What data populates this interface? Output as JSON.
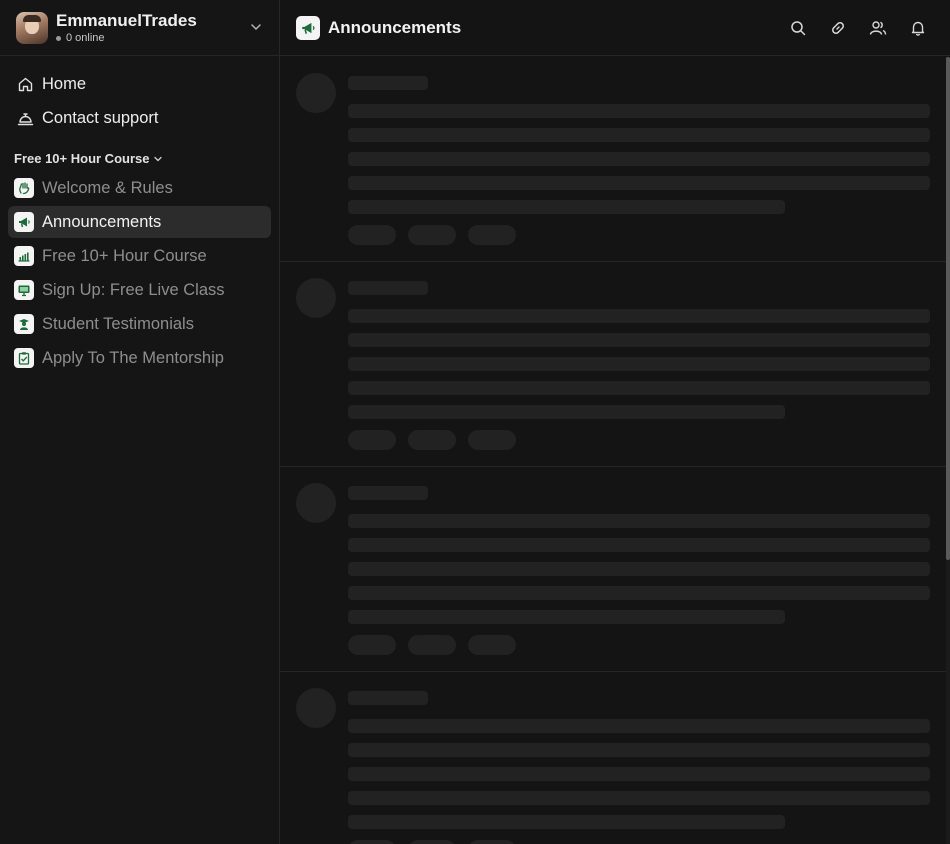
{
  "server": {
    "name": "EmmanuelTrades",
    "online": "0 online"
  },
  "nav": [
    {
      "label": "Home",
      "icon": "home-icon"
    },
    {
      "label": "Contact support",
      "icon": "bell-desk-icon"
    }
  ],
  "section": {
    "title": "Free 10+ Hour Course"
  },
  "channels": [
    {
      "label": "Welcome & Rules",
      "icon": "waving-hand-icon",
      "active": false
    },
    {
      "label": "Announcements",
      "icon": "megaphone-icon",
      "active": true
    },
    {
      "label": "Free 10+ Hour Course",
      "icon": "chart-bars-icon",
      "active": false
    },
    {
      "label": "Sign Up: Free Live Class",
      "icon": "monitor-icon",
      "active": false
    },
    {
      "label": "Student Testimonials",
      "icon": "graduate-icon",
      "active": false
    },
    {
      "label": "Apply To The Mentorship",
      "icon": "clipboard-icon",
      "active": false
    }
  ],
  "header": {
    "title": "Announcements",
    "icons": [
      "search-icon",
      "link-icon",
      "members-icon",
      "notification-bell-icon"
    ]
  },
  "colors": {
    "background": "#141414",
    "brand_green": "#1e6b3a",
    "active_item": "#2c2c2c",
    "skeleton": "#222222"
  }
}
